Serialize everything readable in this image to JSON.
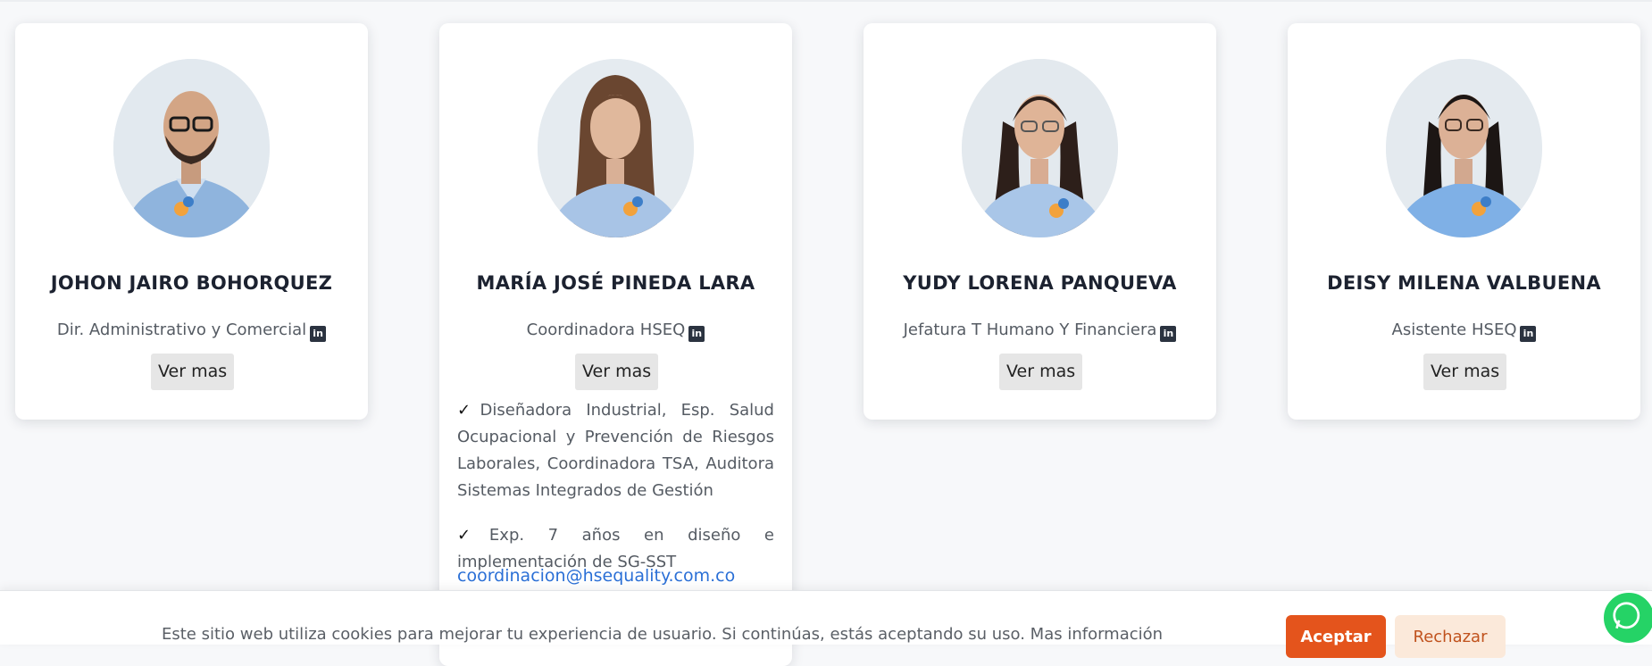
{
  "team": [
    {
      "name": "JOHON JAIRO BOHORQUEZ",
      "role": "Dir. Administrativo y Comercial",
      "button_label": "Ver mas",
      "linkedin_icon": "linkedin-icon"
    },
    {
      "name": "MARÍA JOSÉ PINEDA LARA",
      "role": "Coordinadora HSEQ",
      "button_label": "Ver mas",
      "linkedin_icon": "linkedin-icon",
      "bio_checkmark": "✓",
      "bio_1": "Diseñadora Industrial, Esp. Salud Ocupacional y Prevención de Riesgos Laborales, Coordinadora TSA, Auditora Sistemas Integrados de Gestión",
      "bio_2": "Exp. 7 años en diseño e implementación de SG-SST",
      "email": "coordinacion@hsequality.com.co"
    },
    {
      "name": "YUDY LORENA PANQUEVA",
      "role": "Jefatura T Humano Y Financiera",
      "button_label": "Ver mas",
      "linkedin_icon": "linkedin-icon"
    },
    {
      "name": "DEISY MILENA VALBUENA",
      "role": "Asistente HSEQ",
      "button_label": "Ver mas",
      "linkedin_icon": "linkedin-icon"
    }
  ],
  "cookie_bar": {
    "text": "Este sitio web utiliza cookies para mejorar tu experiencia de usuario. Si continúas, estás aceptando su uso. Mas información",
    "accept_label": "Aceptar",
    "reject_label": "Rechazar"
  },
  "colors": {
    "accent": "#e4541c",
    "reject_bg": "#fbe9da",
    "link": "#2a6fd6",
    "heading": "#1c2230",
    "whatsapp": "#25d366"
  },
  "icons": {
    "linkedin": "linkedin-icon",
    "whatsapp": "whatsapp-icon"
  }
}
